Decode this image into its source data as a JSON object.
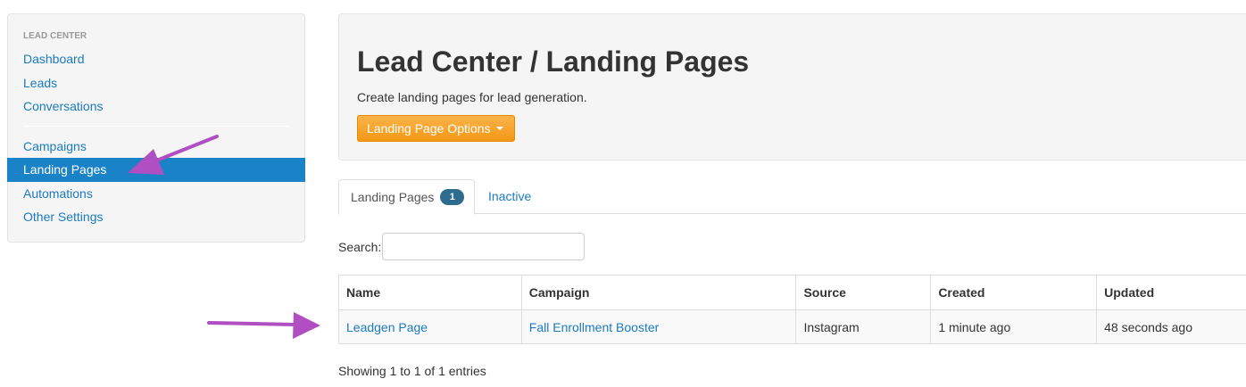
{
  "sidebar": {
    "header": "LEAD CENTER",
    "group1": [
      {
        "label": "Dashboard"
      },
      {
        "label": "Leads"
      },
      {
        "label": "Conversations"
      }
    ],
    "group2": [
      {
        "label": "Campaigns",
        "active": false
      },
      {
        "label": "Landing Pages",
        "active": true
      },
      {
        "label": "Automations",
        "active": false
      },
      {
        "label": "Other Settings",
        "active": false
      }
    ]
  },
  "hero": {
    "title": "Lead Center / Landing Pages",
    "subtitle": "Create landing pages for lead generation.",
    "options_label": "Landing Page Options"
  },
  "tabs": {
    "landing_pages": {
      "label": "Landing Pages",
      "count": "1"
    },
    "inactive": {
      "label": "Inactive"
    }
  },
  "search": {
    "label": "Search:",
    "value": ""
  },
  "table": {
    "columns": [
      "Name",
      "Campaign",
      "Source",
      "Created",
      "Updated"
    ],
    "rows": [
      {
        "name": "Leadgen Page",
        "campaign": "Fall Enrollment Booster",
        "source": "Instagram",
        "created": "1 minute ago",
        "updated": "48 seconds ago"
      }
    ]
  },
  "info_text": "Showing 1 to 1 of 1 entries",
  "colors": {
    "link": "#1a7bbf",
    "active_nav": "#1a83c8",
    "options_button": "#f39815",
    "badge": "#2e6c8e",
    "annotation_arrow": "#b04fc2"
  },
  "icons": {
    "options_caret": "caret-down-icon",
    "annotation": "arrow-annotation-icon"
  }
}
